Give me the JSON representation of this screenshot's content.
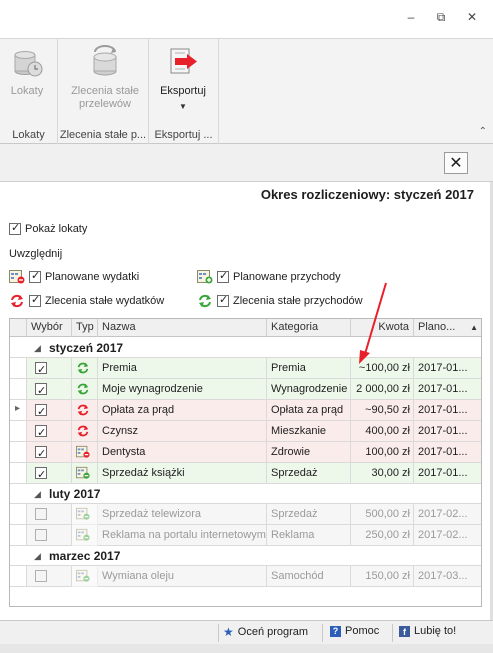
{
  "window": {
    "min": "–",
    "max": "⧉",
    "close": "✕"
  },
  "ribbon": {
    "groups": [
      {
        "button": "Lokaty",
        "label": "Lokaty"
      },
      {
        "button_line1": "Zlecenia stałe",
        "button_line2": "przelewów",
        "label": "Zlecenia stałe p..."
      },
      {
        "button": "Eksportuj",
        "label": "Eksportuj ..."
      }
    ],
    "collapse": "⌃"
  },
  "tab": {
    "close": "✕"
  },
  "period": "Okres rozliczeniowy: styczeń 2017",
  "options": {
    "show_deposits": "Pokaż lokaty",
    "include": "Uwzględnij",
    "planned_expenses": "Planowane wydatki",
    "planned_income": "Planowane przychody",
    "standing_expenses": "Zlecenia stałe wydatków",
    "standing_income": "Zlecenia stałe przychodów"
  },
  "grid": {
    "columns": [
      "Wybór",
      "Typ",
      "Nazwa",
      "Kategoria",
      "Kwota",
      "Plano..."
    ],
    "sort_icon": "▲",
    "groups": [
      {
        "title": "styczeń 2017",
        "rows": [
          {
            "name": "Premia",
            "category": "Premia",
            "amount": "~100,00 zł",
            "planned": "2017-01...",
            "kind": "green"
          },
          {
            "name": "Moje wynagrodzenie",
            "category": "Wynagrodzenie",
            "amount": "2 000,00 zł",
            "planned": "2017-01...",
            "kind": "green"
          },
          {
            "name": "Opłata za prąd",
            "category": "Opłata za prąd",
            "amount": "~90,50 zł",
            "planned": "2017-01...",
            "kind": "red"
          },
          {
            "name": "Czynsz",
            "category": "Mieszkanie",
            "amount": "400,00 zł",
            "planned": "2017-01...",
            "kind": "red"
          },
          {
            "name": "Dentysta",
            "category": "Zdrowie",
            "amount": "100,00 zł",
            "planned": "2017-01...",
            "kind": "red"
          },
          {
            "name": "Sprzedaż książki",
            "category": "Sprzedaż",
            "amount": "30,00 zł",
            "planned": "2017-01...",
            "kind": "green"
          }
        ]
      },
      {
        "title": "luty 2017",
        "rows": [
          {
            "name": "Sprzedaż telewizora",
            "category": "Sprzedaż",
            "amount": "500,00 zł",
            "planned": "2017-02...",
            "kind": "gray"
          },
          {
            "name": "Reklama na portalu internetowym",
            "category": "Reklama",
            "amount": "250,00 zł",
            "planned": "2017-02...",
            "kind": "gray"
          }
        ]
      },
      {
        "title": "marzec 2017",
        "rows": [
          {
            "name": "Wymiana oleju",
            "category": "Samochód",
            "amount": "150,00 zł",
            "planned": "2017-03...",
            "kind": "gray"
          }
        ]
      }
    ]
  },
  "status": {
    "rate": "Oceń program",
    "help": "Pomoc",
    "like": "Lubię to!"
  },
  "colors": {
    "accent_red": "#e8202a",
    "income_green": "#eef8ea",
    "expense_red": "#fbecec"
  }
}
